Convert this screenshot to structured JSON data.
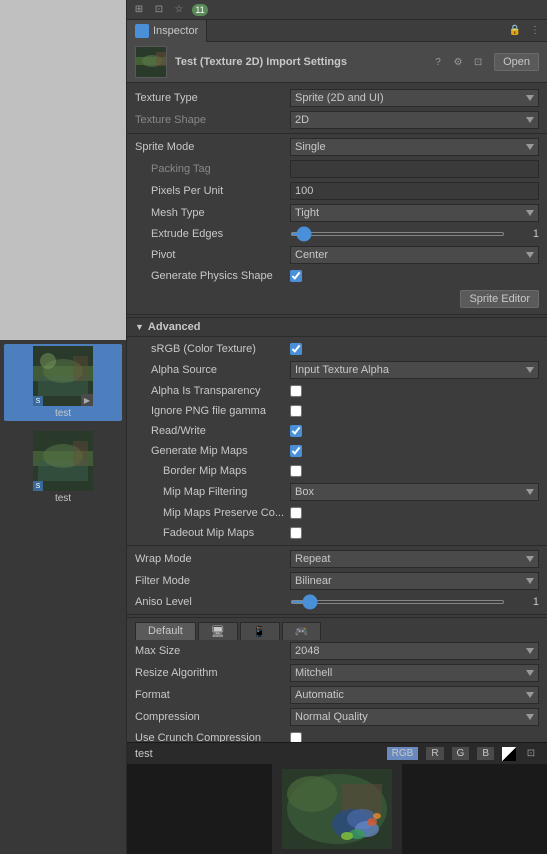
{
  "topBar": {
    "icons": [
      "☰",
      "▶",
      "⊞"
    ],
    "badge": "11"
  },
  "tab": {
    "label": "Inspector",
    "iconColor": "#4a90d9"
  },
  "inspectorHeader": {
    "title": "Test (Texture 2D) Import Settings",
    "openBtn": "Open"
  },
  "properties": {
    "textureType": {
      "label": "Texture Type",
      "value": "Sprite (2D and UI)"
    },
    "textureShape": {
      "label": "Texture Shape",
      "value": "2D"
    },
    "spriteMode": {
      "label": "Sprite Mode",
      "value": "Single"
    },
    "packingTag": {
      "label": "Packing Tag",
      "value": ""
    },
    "pixelsPerUnit": {
      "label": "Pixels Per Unit",
      "value": "100"
    },
    "meshType": {
      "label": "Mesh Type",
      "value": "Tight"
    },
    "extrudeEdges": {
      "label": "Extrude Edges",
      "sliderValue": 1,
      "sliderMin": 0,
      "sliderMax": 32
    },
    "pivot": {
      "label": "Pivot",
      "value": "Center"
    },
    "generatePhysicsShape": {
      "label": "Generate Physics Shape",
      "checked": true
    },
    "spriteEditorBtn": "Sprite Editor"
  },
  "advanced": {
    "label": "Advanced",
    "srgb": {
      "label": "sRGB (Color Texture)",
      "checked": true
    },
    "alphaSource": {
      "label": "Alpha Source",
      "value": "Input Texture Alpha"
    },
    "alphaIsTransparency": {
      "label": "Alpha Is Transparency",
      "checked": false
    },
    "ignorePNGGamma": {
      "label": "Ignore PNG file gamma",
      "checked": false
    },
    "readWrite": {
      "label": "Read/Write",
      "checked": true
    },
    "generateMipMaps": {
      "label": "Generate Mip Maps",
      "checked": true
    },
    "borderMipMaps": {
      "label": "Border Mip Maps",
      "checked": false
    },
    "mipMapFiltering": {
      "label": "Mip Map Filtering",
      "value": "Box"
    },
    "mipMapsPreserveCoverage": {
      "label": "Mip Maps Preserve Co...",
      "checked": false
    },
    "fadeoutMipMaps": {
      "label": "Fadeout Mip Maps",
      "checked": false
    }
  },
  "wrapMode": {
    "label": "Wrap Mode",
    "value": "Repeat"
  },
  "filterMode": {
    "label": "Filter Mode",
    "value": "Bilinear"
  },
  "anisoLevel": {
    "label": "Aniso Level",
    "sliderValue": 1,
    "sliderMin": 0,
    "sliderMax": 16
  },
  "platformTabs": [
    {
      "label": "Default",
      "icon": "🖥",
      "active": true
    },
    {
      "label": "",
      "icon": "🖥",
      "active": false
    },
    {
      "label": "",
      "icon": "📱",
      "active": false
    },
    {
      "label": "",
      "icon": "🎮",
      "active": false
    }
  ],
  "platformSettings": {
    "maxSize": {
      "label": "Max Size",
      "value": "2048"
    },
    "resizeAlgorithm": {
      "label": "Resize Algorithm",
      "value": "Mitchell"
    },
    "format": {
      "label": "Format",
      "value": "Automatic"
    },
    "compression": {
      "label": "Compression",
      "value": "Normal Quality"
    },
    "useCrunchCompression": {
      "label": "Use Crunch Compression",
      "checked": false
    }
  },
  "preview": {
    "label": "test",
    "channels": [
      "RGB",
      "R",
      "G",
      "B"
    ],
    "alphaToggle": true
  }
}
